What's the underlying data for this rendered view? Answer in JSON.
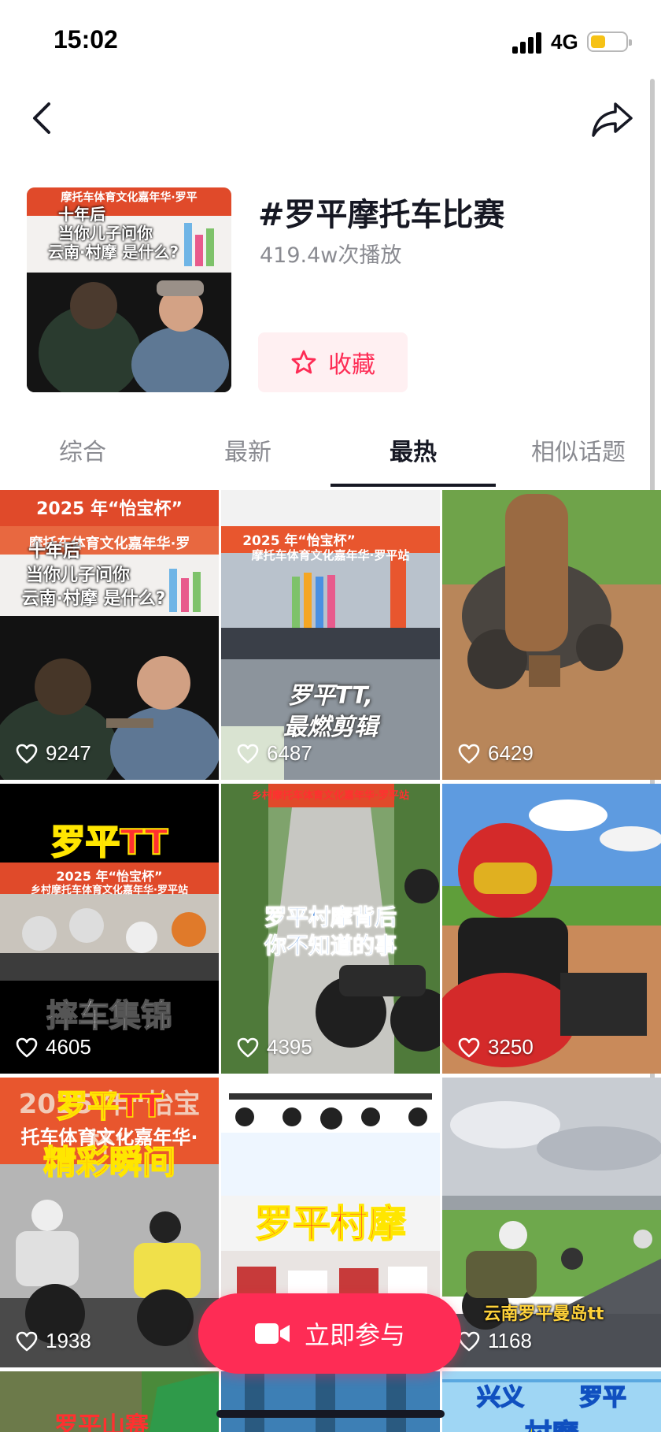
{
  "status": {
    "time": "15:02",
    "network": "4G"
  },
  "topic": {
    "title": "#罗平摩托车比赛",
    "plays": "419.4w次播放",
    "fav_label": "收藏"
  },
  "cover_text": {
    "line1": "十年后",
    "line2": "当你儿子问你",
    "line3": "云南·村摩 是什么?",
    "banner": "摩托车体育文化嘉年华·罗平"
  },
  "tabs": [
    "综合",
    "最新",
    "最热",
    "相似话题"
  ],
  "videos": [
    {
      "likes": "9247",
      "line1": "2025 年“怡宝杯”",
      "line2": "摩托车体育文化嘉年华·罗",
      "line3": "十年后",
      "line4": "当你儿子问你",
      "line5": "云南·村摩 是什么?"
    },
    {
      "likes": "6487",
      "line1": "2025 年“怡宝杯”",
      "line2": "摩托车体育文化嘉年华·罗平站",
      "line3": "罗平TT,",
      "line4": "最燃剪辑"
    },
    {
      "likes": "6429"
    },
    {
      "likes": "4605",
      "line1": "罗平TT",
      "line2": "2025 年“怡宝杯”",
      "line3": "乡村摩托车体育文化嘉年华·罗平站",
      "line4": "摔车集锦"
    },
    {
      "likes": "4395",
      "line1": "乡村摩托车体育文化嘉年华·罗平站",
      "line2": "罗平村摩背后",
      "line3": "你不知道的事"
    },
    {
      "likes": "3250"
    },
    {
      "likes": "1938",
      "line1": "2025 年“怡宝杯”",
      "line2": "托车体育文化嘉年华·",
      "line3": "罗平TT",
      "line4": "精彩瞬间"
    },
    {
      "likes": "",
      "line1": "罗平村摩"
    },
    {
      "likes": "1168",
      "line1": "云南罗平曼岛tt"
    }
  ],
  "partial_row": {
    "left": "罗平山赛",
    "right_a": "兴义",
    "right_b": "罗平",
    "right_c": "村摩"
  },
  "cta": {
    "label": "立即参与"
  },
  "colors": {
    "accent": "#fe2c55",
    "fav_bg": "#fff0f2",
    "text": "#161823",
    "muted": "#8a8b91"
  }
}
